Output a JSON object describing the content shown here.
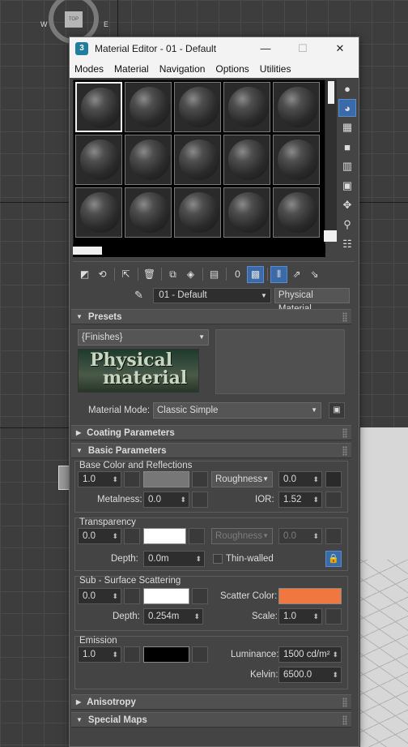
{
  "viewport": {
    "viewcube_top": "TOP",
    "viewcube_w": "W",
    "viewcube_e": "E"
  },
  "window": {
    "icon_text": "3",
    "title": "Material Editor - 01 - Default",
    "minimize": "—",
    "maximize": "☐",
    "close": "✕"
  },
  "menu": [
    "Modes",
    "Material",
    "Navigation",
    "Options",
    "Utilities"
  ],
  "material_slot_count": 15,
  "name_row": {
    "material_name": "01 - Default",
    "material_type": "Physical Material"
  },
  "presets": {
    "title": "Presets",
    "preset_value": "{Finishes}",
    "banner_line1": "Physical",
    "banner_line2": "material",
    "mode_label": "Material Mode:",
    "mode_value": "Classic Simple"
  },
  "coating": {
    "title": "Coating Parameters"
  },
  "basic": {
    "title": "Basic Parameters",
    "base": {
      "title": "Base Color and Reflections",
      "weight": "1.0",
      "color": "#777777",
      "roughness_mode": "Roughness",
      "roughness": "0.0",
      "metalness_label": "Metalness:",
      "metalness": "0.0",
      "ior_label": "IOR:",
      "ior": "1.52"
    },
    "transparency": {
      "title": "Transparency",
      "weight": "0.0",
      "color": "#ffffff",
      "roughness_mode": "Roughness",
      "roughness": "0.0",
      "depth_label": "Depth:",
      "depth": "0.0m",
      "thin_walled": "Thin-walled"
    },
    "sss": {
      "title": "Sub - Surface Scattering",
      "weight": "0.0",
      "color": "#ffffff",
      "scatter_label": "Scatter Color:",
      "scatter_color": "#f07840",
      "depth_label": "Depth:",
      "depth": "0.254m",
      "scale_label": "Scale:",
      "scale": "1.0"
    },
    "emission": {
      "title": "Emission",
      "weight": "1.0",
      "color": "#000000",
      "luminance_label": "Luminance:",
      "luminance": "1500 cd/m²",
      "kelvin_label": "Kelvin:",
      "kelvin": "6500.0"
    }
  },
  "anisotropy": {
    "title": "Anisotropy"
  },
  "special_maps": {
    "title": "Special Maps"
  }
}
